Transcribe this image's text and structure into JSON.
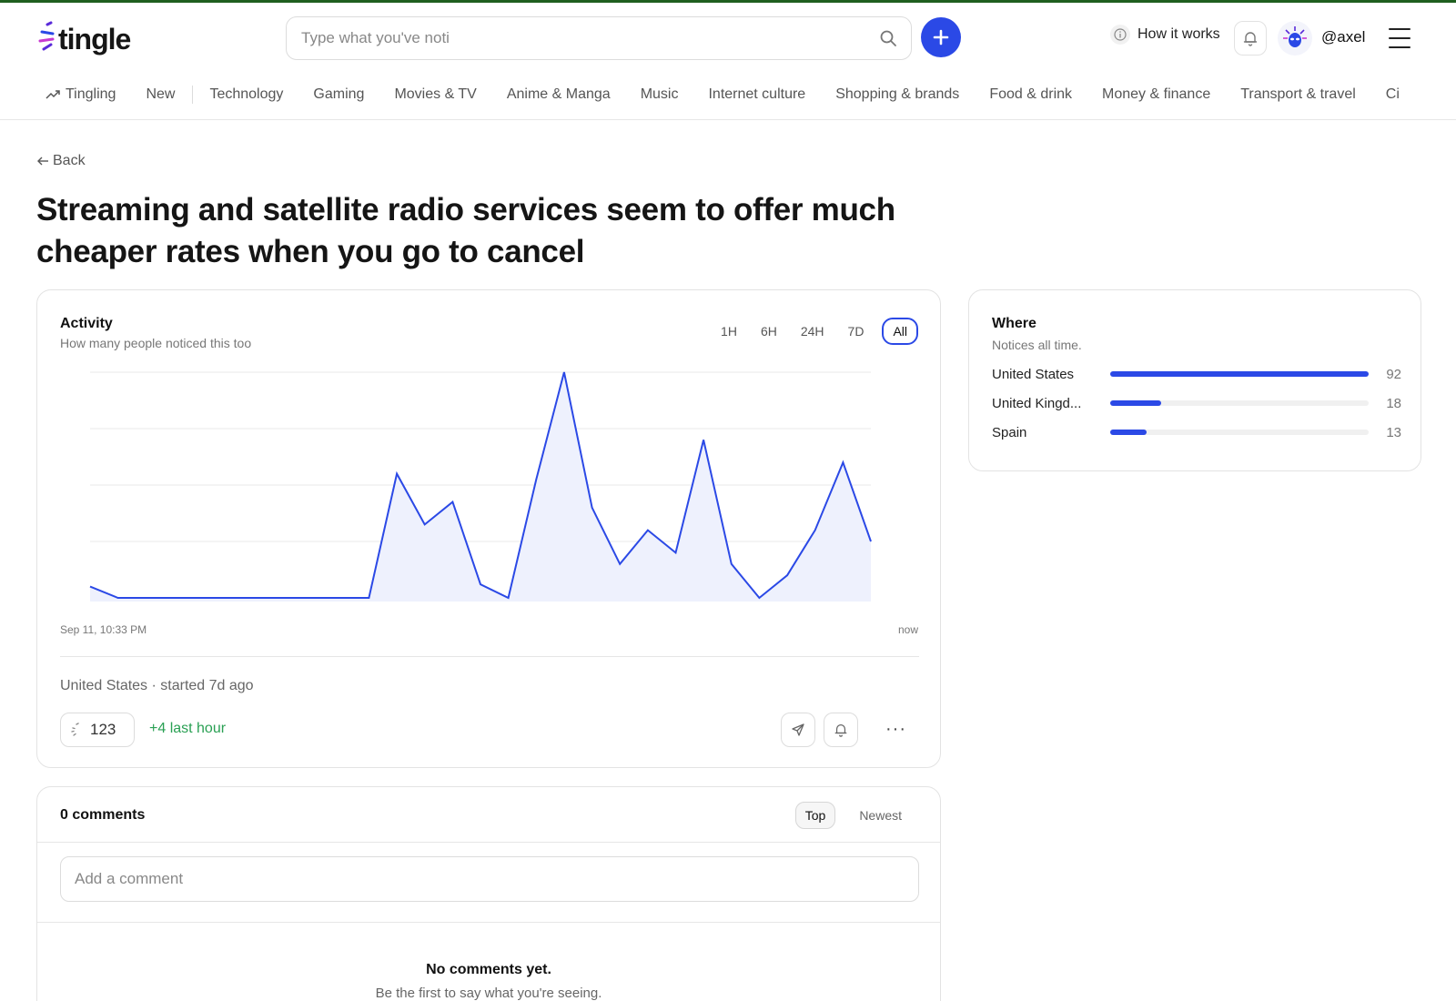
{
  "app": {
    "logo_text": "tingle",
    "brand_color": "#2b49e6",
    "accent_green": "#2aa054"
  },
  "header": {
    "search_placeholder": "Type what you've noti",
    "how_it_works": "How it works",
    "username": "@axel",
    "icons": [
      "search-icon",
      "plus-icon",
      "info-icon",
      "bell-icon",
      "alien-avatar-icon",
      "hamburger-menu-icon"
    ]
  },
  "nav": {
    "items": [
      {
        "label": "Tingling",
        "icon": "trending-icon"
      },
      {
        "label": "New"
      },
      {
        "label": "Technology"
      },
      {
        "label": "Gaming"
      },
      {
        "label": "Movies & TV"
      },
      {
        "label": "Anime & Manga"
      },
      {
        "label": "Music"
      },
      {
        "label": "Internet culture"
      },
      {
        "label": "Shopping & brands"
      },
      {
        "label": "Food & drink"
      },
      {
        "label": "Money & finance"
      },
      {
        "label": "Transport & travel"
      },
      {
        "label": "Ci"
      }
    ]
  },
  "page": {
    "back_label": "Back",
    "title": "Streaming and satellite radio services seem to offer much cheaper rates when you go to cancel"
  },
  "activity": {
    "title": "Activity",
    "subtitle": "How many people noticed this too",
    "ranges": [
      "1H",
      "6H",
      "24H",
      "7D",
      "All"
    ],
    "active_range": "All",
    "x_start_label": "Sep 11, 10:33 PM",
    "x_end_label": "now",
    "meta": "United States · started 7d ago",
    "count": "123",
    "last_hour": "+4 last hour"
  },
  "chart_data": {
    "type": "area",
    "title": "",
    "xlabel": "",
    "ylabel": "",
    "x_labels": [
      "Sep 11, 10:33 PM",
      "now"
    ],
    "values": [
      1,
      0,
      0,
      0,
      0,
      0,
      0,
      0,
      0,
      0,
      0,
      11,
      6.5,
      8.5,
      1.2,
      0,
      10.5,
      20,
      8,
      3,
      6,
      4,
      14,
      3,
      0,
      2,
      6,
      12,
      5
    ],
    "ylim": [
      0,
      20
    ],
    "grid": true,
    "color": "#2b49e6"
  },
  "where": {
    "title": "Where",
    "subtitle": "Notices all time.",
    "locations": [
      {
        "name": "United States",
        "count": "92",
        "value": 92
      },
      {
        "name": "United Kingd...",
        "count": "18",
        "value": 18
      },
      {
        "name": "Spain",
        "count": "13",
        "value": 13
      }
    ],
    "max": 92
  },
  "comments": {
    "heading": "0 comments",
    "sort_options": [
      "Top",
      "Newest"
    ],
    "active_sort": "Top",
    "input_placeholder": "Add a comment",
    "empty_title": "No comments yet.",
    "empty_subtitle": "Be the first to say what you're seeing."
  }
}
